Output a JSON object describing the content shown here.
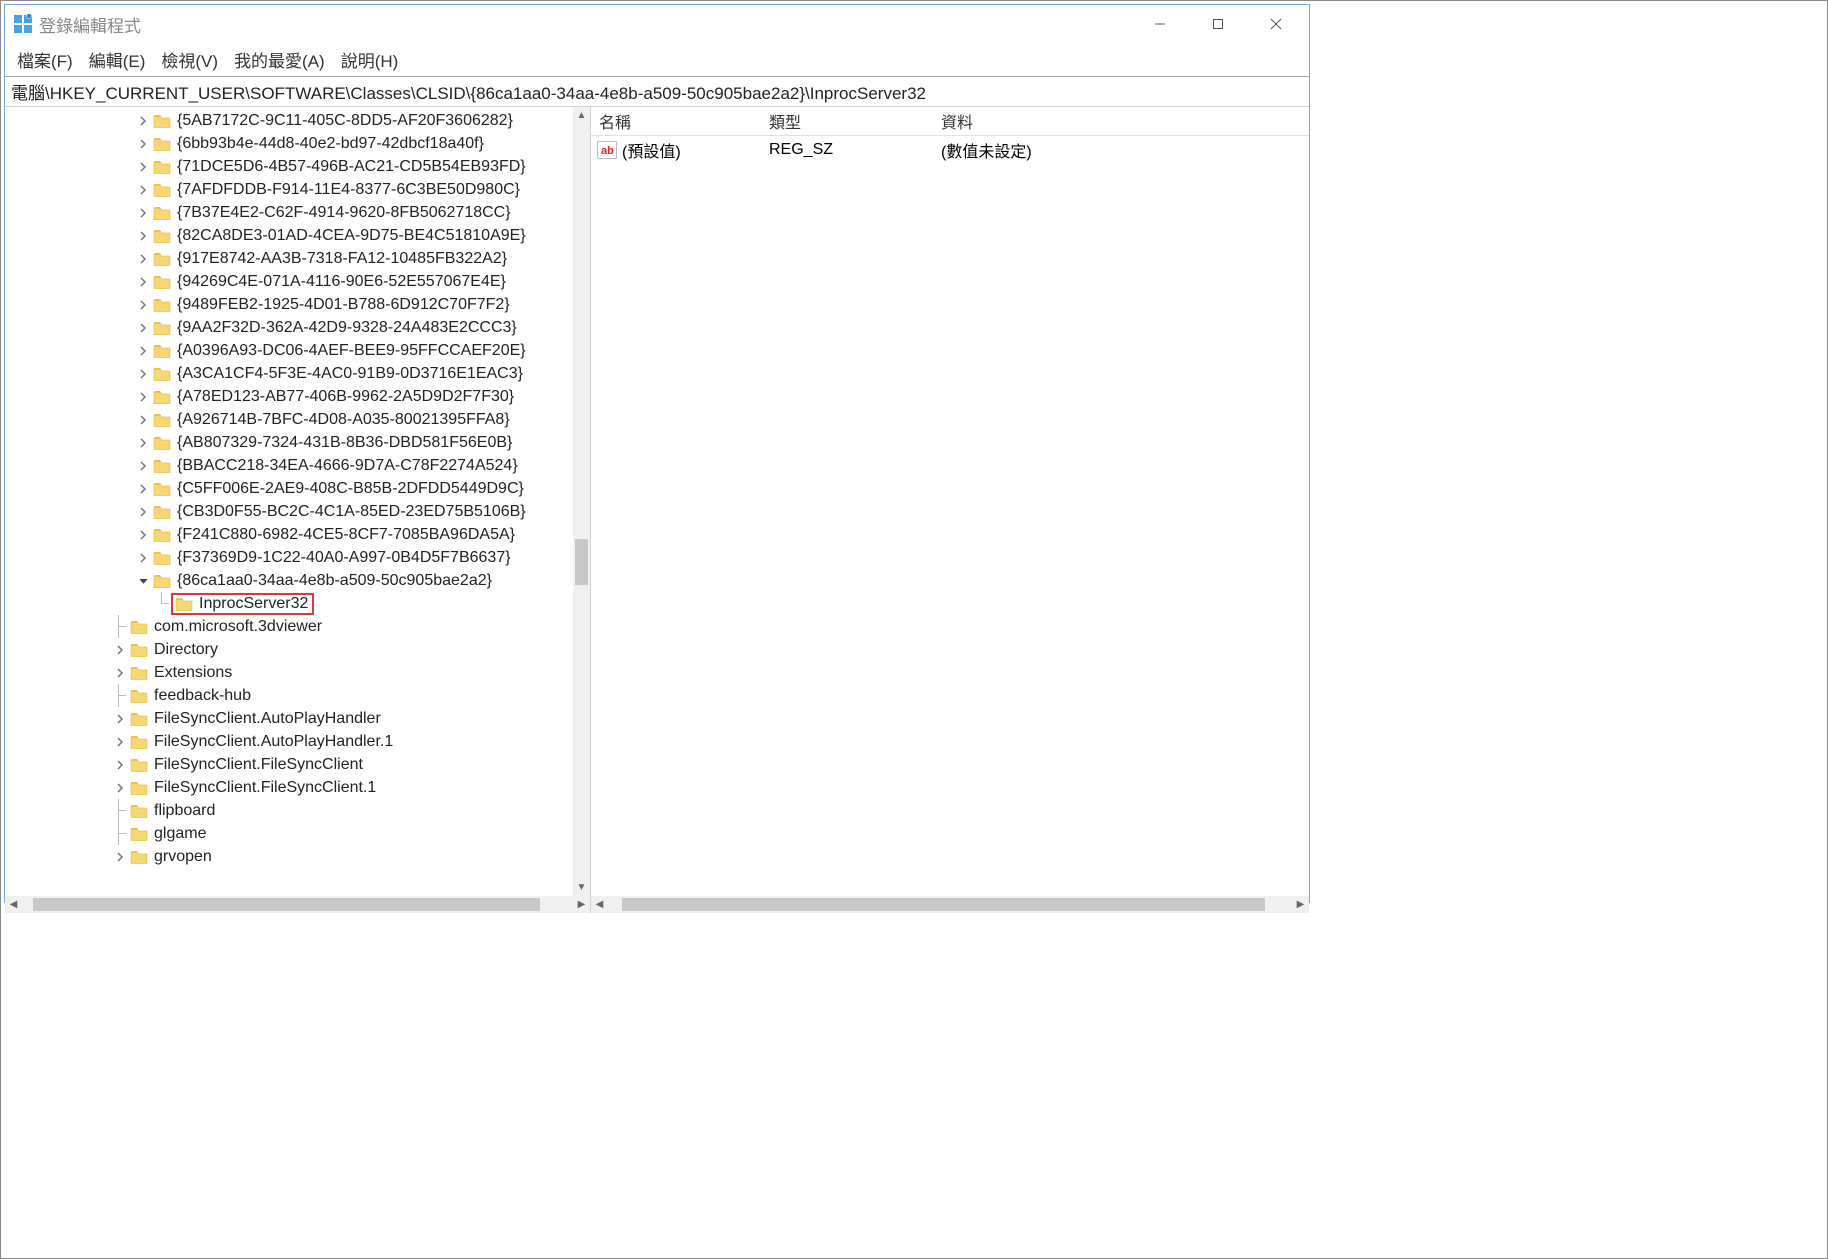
{
  "window": {
    "title": "登錄編輯程式"
  },
  "menu": {
    "file": "檔案(F)",
    "edit": "編輯(E)",
    "view": "檢視(V)",
    "favorites": "我的最愛(A)",
    "help": "說明(H)"
  },
  "addressbar": "電腦\\HKEY_CURRENT_USER\\SOFTWARE\\Classes\\CLSID\\{86ca1aa0-34aa-4e8b-a509-50c905bae2a2}\\InprocServer32",
  "tree": {
    "clsid_items": [
      "{5AB7172C-9C11-405C-8DD5-AF20F3606282}",
      "{6bb93b4e-44d8-40e2-bd97-42dbcf18a40f}",
      "{71DCE5D6-4B57-496B-AC21-CD5B54EB93FD}",
      "{7AFDFDDB-F914-11E4-8377-6C3BE50D980C}",
      "{7B37E4E2-C62F-4914-9620-8FB5062718CC}",
      "{82CA8DE3-01AD-4CEA-9D75-BE4C51810A9E}",
      "{917E8742-AA3B-7318-FA12-10485FB322A2}",
      "{94269C4E-071A-4116-90E6-52E557067E4E}",
      "{9489FEB2-1925-4D01-B788-6D912C70F7F2}",
      "{9AA2F32D-362A-42D9-9328-24A483E2CCC3}",
      "{A0396A93-DC06-4AEF-BEE9-95FFCCAEF20E}",
      "{A3CA1CF4-5F3E-4AC0-91B9-0D3716E1EAC3}",
      "{A78ED123-AB77-406B-9962-2A5D9D2F7F30}",
      "{A926714B-7BFC-4D08-A035-80021395FFA8}",
      "{AB807329-7324-431B-8B36-DBD581F56E0B}",
      "{BBACC218-34EA-4666-9D7A-C78F2274A524}",
      "{C5FF006E-2AE9-408C-B85B-2DFDD5449D9C}",
      "{CB3D0F55-BC2C-4C1A-85ED-23ED75B5106B}",
      "{F241C880-6982-4CE5-8CF7-7085BA96DA5A}",
      "{F37369D9-1C22-40A0-A997-0B4D5F7B6637}"
    ],
    "expanded_key": "{86ca1aa0-34aa-4e8b-a509-50c905bae2a2}",
    "selected_child": "InprocServer32",
    "after_items": [
      {
        "label": "com.microsoft.3dviewer",
        "arrow": "none",
        "connector": true
      },
      {
        "label": "Directory",
        "arrow": "closed"
      },
      {
        "label": "Extensions",
        "arrow": "closed"
      },
      {
        "label": "feedback-hub",
        "arrow": "none",
        "connector": true
      },
      {
        "label": "FileSyncClient.AutoPlayHandler",
        "arrow": "closed"
      },
      {
        "label": "FileSyncClient.AutoPlayHandler.1",
        "arrow": "closed"
      },
      {
        "label": "FileSyncClient.FileSyncClient",
        "arrow": "closed"
      },
      {
        "label": "FileSyncClient.FileSyncClient.1",
        "arrow": "closed"
      },
      {
        "label": "flipboard",
        "arrow": "none",
        "connector": true
      },
      {
        "label": "glgame",
        "arrow": "none",
        "connector": true
      },
      {
        "label": "grvopen",
        "arrow": "closed"
      }
    ]
  },
  "list": {
    "headers": {
      "name": "名稱",
      "type": "類型",
      "data": "資料"
    },
    "rows": [
      {
        "name": "(預設值)",
        "type": "REG_SZ",
        "data": "(數值未設定)"
      }
    ]
  }
}
